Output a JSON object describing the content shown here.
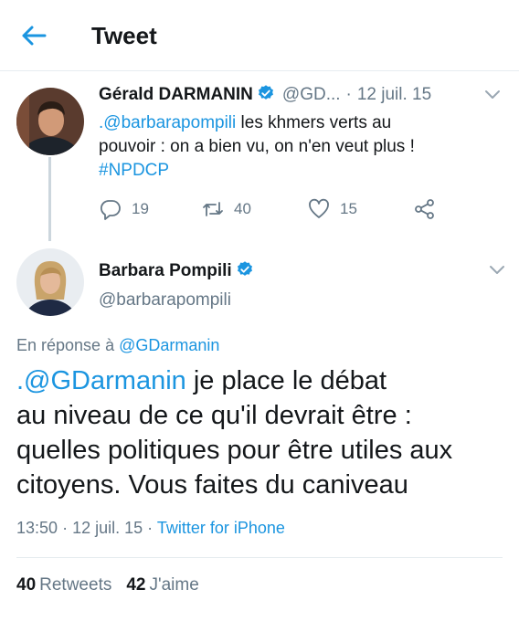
{
  "header": {
    "title": "Tweet"
  },
  "tweet1": {
    "author_name": "Gérald DARMANIN",
    "handle": "@GD...",
    "dot": "·",
    "date": "12 juil. 15",
    "text": {
      "mention": ".@barbarapompili",
      "line1_rest": " les khmers verts au",
      "line2": "pouvoir : on a bien vu, on n'en veut plus !",
      "hashtag": "#NPDCP"
    },
    "replies": "19",
    "retweets": "40",
    "likes": "15"
  },
  "tweet2": {
    "author_name": "Barbara Pompili",
    "handle": "@barbarapompili",
    "reply_prefix": "En réponse à",
    "reply_handle": "@GDarmanin",
    "text": {
      "mention": ".@GDarmanin",
      "line1_rest": " je place le débat",
      "line2": "au niveau de ce qu'il devrait être :",
      "line3": "quelles politiques pour être utiles aux",
      "line4": "citoyens. Vous faites du caniveau"
    },
    "time": "13:50",
    "dot": "·",
    "date": "12 juil. 15",
    "dot2": "·",
    "source": "Twitter for iPhone",
    "retweets_count": "40",
    "retweets_label": "Retweets",
    "likes_count": "42",
    "likes_label": "J'aime"
  },
  "colors": {
    "accent": "#1b95e0",
    "text": "#14171a",
    "muted": "#657786",
    "divider": "#e6ecf0"
  }
}
